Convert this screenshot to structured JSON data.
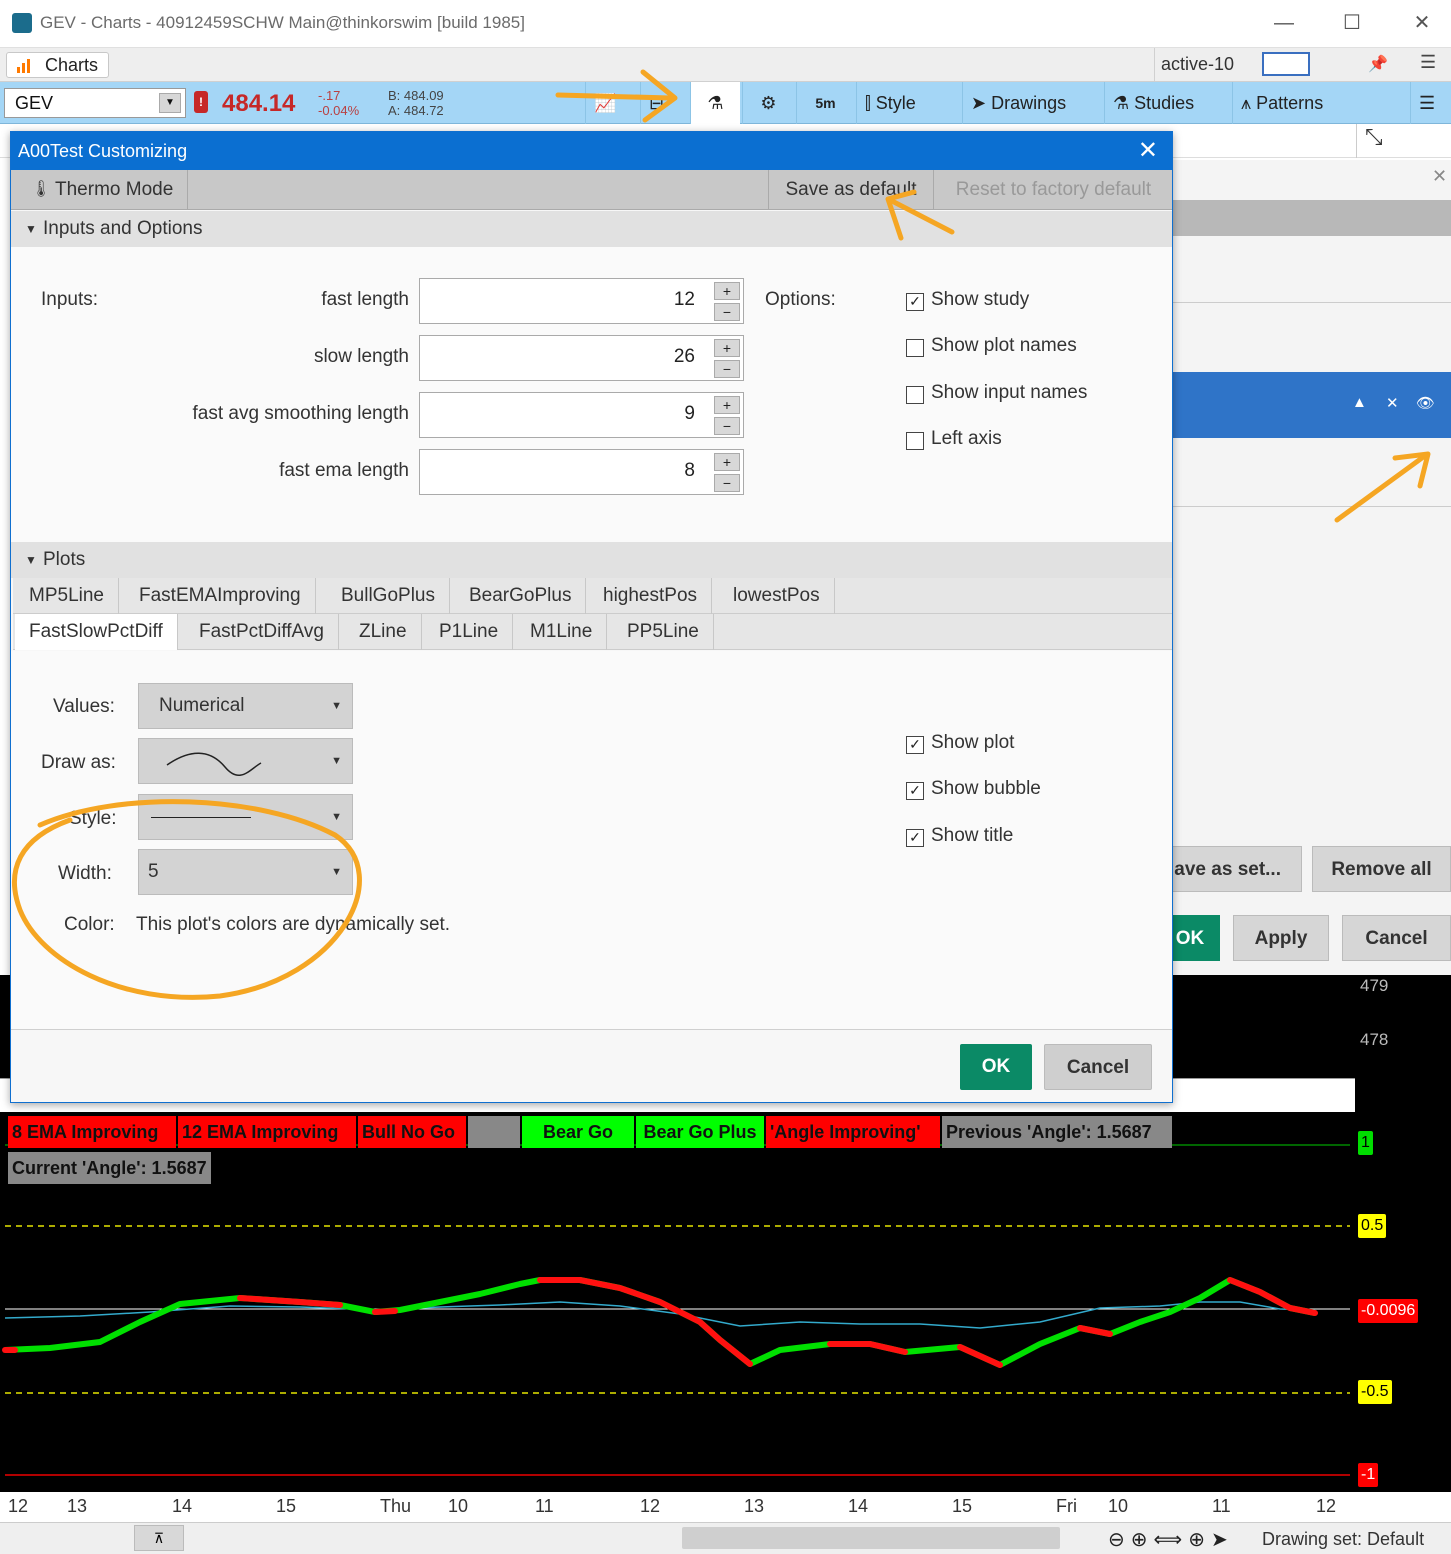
{
  "window": {
    "title": "GEV - Charts - 40912459SCHW Main@thinkorswim [build 1985]",
    "minimize": "—",
    "maximize": "☐",
    "close": "✕"
  },
  "menubar": {
    "charts_tab": "Charts",
    "active_label": "active-10"
  },
  "toolbar": {
    "symbol": "GEV",
    "alert": "!",
    "price": "484.14",
    "change": "-.17",
    "change_pct": "-0.04%",
    "bid": "B: 484.09",
    "ask": "A: 484.72",
    "timeframe": "5m",
    "style": "Style",
    "drawings": "Drawings",
    "studies": "Studies",
    "patterns": "Patterns"
  },
  "background_panel": {
    "save_as_set": "ave as set...",
    "remove_all": "Remove all",
    "ok": "OK",
    "apply": "Apply",
    "cancel": "Cancel"
  },
  "dialog": {
    "title": "A00Test Customizing",
    "thermo_mode": "Thermo Mode",
    "save_default": "Save as default",
    "reset_default": "Reset to factory default",
    "inputs_section": "Inputs and Options",
    "inputs_label": "Inputs:",
    "options_label": "Options:",
    "inputs": [
      {
        "name": "fast length",
        "value": "12"
      },
      {
        "name": "slow length",
        "value": "26"
      },
      {
        "name": "fast avg smoothing length",
        "value": "9"
      },
      {
        "name": "fast ema length",
        "value": "8"
      }
    ],
    "options": [
      {
        "label": "Show study",
        "checked": true
      },
      {
        "label": "Show plot names",
        "checked": false
      },
      {
        "label": "Show input names",
        "checked": false
      },
      {
        "label": "Left axis",
        "checked": false
      }
    ],
    "plots_section": "Plots",
    "plot_tabs_row1": [
      "MP5Line",
      "FastEMAImproving",
      "BullGoPlus",
      "BearGoPlus",
      "highestPos",
      "lowestPos"
    ],
    "plot_tabs_row2": [
      "FastSlowPctDiff",
      "FastPctDiffAvg",
      "ZLine",
      "P1Line",
      "M1Line",
      "PP5Line"
    ],
    "values_label": "Values:",
    "values_value": "Numerical",
    "draw_as_label": "Draw as:",
    "style_label": "Style:",
    "width_label": "Width:",
    "width_value": "5",
    "color_label": "Color:",
    "color_text": "This plot's colors are dynamically set.",
    "plot_options": [
      {
        "label": "Show plot",
        "checked": true
      },
      {
        "label": "Show bubble",
        "checked": true
      },
      {
        "label": "Show title",
        "checked": true
      }
    ],
    "ok": "OK",
    "cancel": "Cancel"
  },
  "chart": {
    "price_axis": [
      "479",
      "478"
    ],
    "labels": [
      {
        "text": "8 EMA Improving",
        "bg": "#ff0000"
      },
      {
        "text": "12 EMA Improving",
        "bg": "#ff0000"
      },
      {
        "text": "Bull No Go",
        "bg": "#ff0000"
      },
      {
        "text": "",
        "bg": "#888888"
      },
      {
        "text": "Bear Go",
        "bg": "#00ff00"
      },
      {
        "text": "Bear Go Plus",
        "bg": "#00ff00"
      },
      {
        "text": "'Angle Improving'",
        "bg": "#ff0000"
      },
      {
        "text": "Previous 'Angle': 1.5687",
        "bg": "#888888"
      }
    ],
    "current_angle": "Current 'Angle': 1.5687",
    "axis_tags": [
      {
        "text": "1",
        "bg": "#00dd00",
        "fg": "#000000"
      },
      {
        "text": "0.5",
        "bg": "#ffff00",
        "fg": "#000000"
      },
      {
        "text": "-0.0096",
        "bg": "#ff0000",
        "fg": "#ffffff"
      },
      {
        "text": "-0.5",
        "bg": "#ffff00",
        "fg": "#000000"
      },
      {
        "text": "-1",
        "bg": "#ff0000",
        "fg": "#ffffff"
      }
    ],
    "time_labels": [
      "12",
      "13",
      "14",
      "15",
      "Thu",
      "10",
      "11",
      "12",
      "13",
      "14",
      "15",
      "Fri",
      "10",
      "11",
      "12"
    ],
    "drawing_set": "Drawing set: Default"
  },
  "annotation_color": "#f5a623"
}
